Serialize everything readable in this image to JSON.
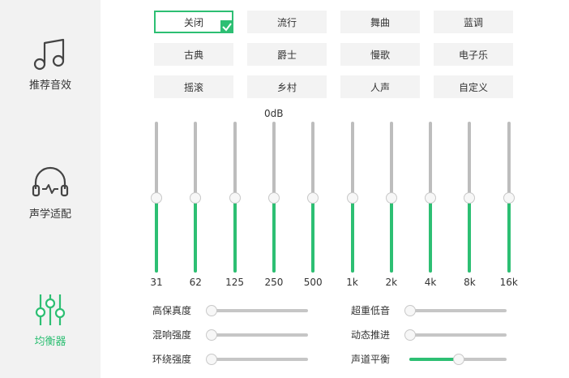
{
  "sidebar": {
    "items": [
      {
        "label": "推荐音效",
        "icon": "music-note-icon"
      },
      {
        "label": "声学适配",
        "icon": "headphones-icon"
      },
      {
        "label": "均衡器",
        "icon": "equalizer-icon",
        "active": true
      }
    ]
  },
  "presets": [
    "关闭",
    "流行",
    "舞曲",
    "蓝调",
    "古典",
    "爵士",
    "慢歌",
    "电子乐",
    "摇滚",
    "乡村",
    "人声",
    "自定义"
  ],
  "selected_preset": "关闭",
  "equalizer": {
    "zero_label": "0dB",
    "bands": [
      {
        "label": "31",
        "level": 0.5
      },
      {
        "label": "62",
        "level": 0.5
      },
      {
        "label": "125",
        "level": 0.5
      },
      {
        "label": "250",
        "level": 0.5
      },
      {
        "label": "500",
        "level": 0.5
      },
      {
        "label": "1k",
        "level": 0.5
      },
      {
        "label": "2k",
        "level": 0.5
      },
      {
        "label": "4k",
        "level": 0.5
      },
      {
        "label": "8k",
        "level": 0.5
      },
      {
        "label": "16k",
        "level": 0.5
      }
    ]
  },
  "controls": [
    {
      "label": "高保真度",
      "value": 0
    },
    {
      "label": "超重低音",
      "value": 0
    },
    {
      "label": "混响强度",
      "value": 0
    },
    {
      "label": "动态推进",
      "value": 0
    },
    {
      "label": "环绕强度",
      "value": 0
    },
    {
      "label": "声道平衡",
      "value": 0.5
    }
  ],
  "colors": {
    "accent": "#2dbf73",
    "track": "#bdbdbd",
    "sidebar_bg": "#f2f2f2"
  }
}
